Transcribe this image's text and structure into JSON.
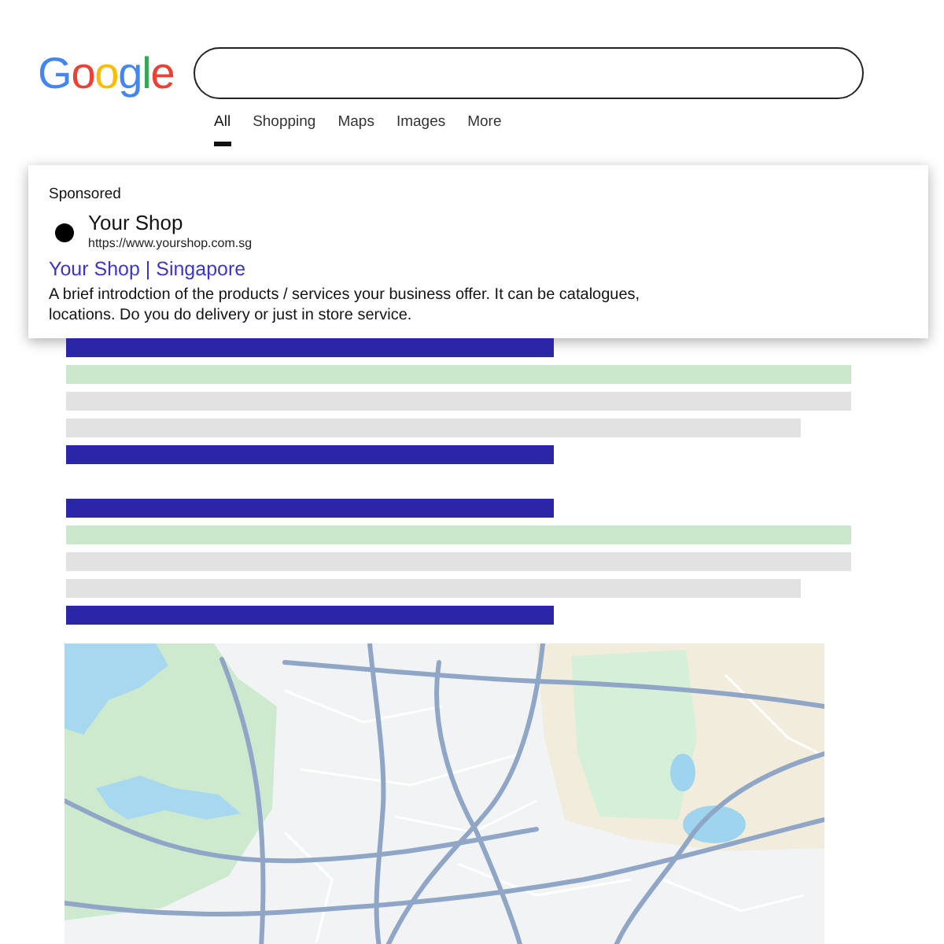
{
  "logo": {
    "letters": [
      {
        "text": "G",
        "color": "#4285f4"
      },
      {
        "text": "o",
        "color": "#ea4335"
      },
      {
        "text": "o",
        "color": "#fbbc05"
      },
      {
        "text": "g",
        "color": "#4285f4"
      },
      {
        "text": "l",
        "color": "#34a853"
      },
      {
        "text": "e",
        "color": "#ea4335"
      }
    ]
  },
  "tabs": [
    {
      "label": "All",
      "selected": true
    },
    {
      "label": "Shopping",
      "selected": false
    },
    {
      "label": "Maps",
      "selected": false
    },
    {
      "label": "Images",
      "selected": false
    },
    {
      "label": "More",
      "selected": false
    }
  ],
  "ad": {
    "label": "Sponsored",
    "site_name": "Your Shop",
    "url": "https://www.yourshop.com.sg",
    "title": "Your Shop | Singapore",
    "description": "A brief introdction of the products / services your business offer. It can be catalogues, locations. Do you do delivery or just in store service."
  },
  "results": [
    {
      "bars": [
        {
          "kind": "title"
        },
        {
          "kind": "url"
        },
        {
          "kind": "text"
        },
        {
          "kind": "short"
        },
        {
          "kind": "title"
        }
      ]
    },
    {
      "bars": [
        {
          "kind": "title"
        },
        {
          "kind": "url"
        },
        {
          "kind": "text"
        },
        {
          "kind": "short"
        },
        {
          "kind": "title"
        }
      ]
    }
  ]
}
